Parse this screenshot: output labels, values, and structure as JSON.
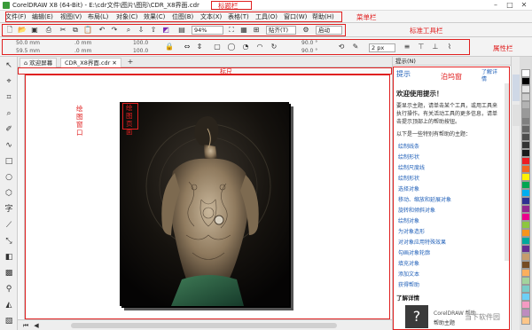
{
  "window": {
    "title": "CorelDRAW X8 (64-Bit) - E:\\cdr文件\\图片\\图形\\CDR_X8界面.cdr",
    "title_annotation": "标题栏"
  },
  "menu": {
    "items": [
      "文件(F)",
      "编辑(E)",
      "视图(V)",
      "布局(L)",
      "对象(C)",
      "效果(C)",
      "位图(B)",
      "文本(X)",
      "表格(T)",
      "工具(O)",
      "窗口(W)",
      "帮助(H)"
    ],
    "annotation": "菜单栏"
  },
  "standard_toolbar": {
    "zoom_value": "94%",
    "snap_label": "贴齐(T)",
    "launch_label": "启动",
    "annotation": "标准工具栏"
  },
  "property_bar": {
    "width_value": "50.0 mm",
    "height_value": "59.5 mm",
    "x_value": ".0 mm",
    "y_value": ".0 mm",
    "scale_x": "100.0",
    "scale_y": "100.0",
    "angle_1": "90.0 °",
    "angle_2": "90.0 °",
    "outline_width": "2 px",
    "annotation": "属性栏"
  },
  "tabs": {
    "welcome": "欢迎屏幕",
    "document": "CDR_X8界面.cdr"
  },
  "annotations": {
    "ruler": "标尺",
    "drawing_window": "绘图窗口",
    "drawing_page": "绘图页面",
    "docker": "泊坞窗"
  },
  "docker": {
    "header": "提示(N)",
    "panel_title": "提示",
    "learn_more": "了解详情",
    "welcome_title": "欢迎使用提示！",
    "intro_lines": [
      "要显示主题，请单击某个工具，或用工具来",
      "执行操作。有关活动工具的更多信息，请单",
      "击提示顶部上的帮助按钮。"
    ],
    "topics_intro": "以下是一些特别有帮助的主题：",
    "topics": [
      "绘制线条",
      "绘制形状",
      "绘制尺度线",
      "绘制形状",
      "选择对象",
      "移动、缩放和延展对象",
      "旋转和倾斜对象",
      "绘制对象",
      "为对象造形",
      "对对象应用特殊效果",
      "勾画对象轮廓",
      "填充对象",
      "添加文本",
      "获得帮助"
    ],
    "more_section": "了解详情",
    "help_box_line1": "CorelDRAW 帮助",
    "help_box_line2": "帮助主题"
  },
  "watermark": "当下软件园",
  "palette_colors": [
    "#ffffff",
    "#000000",
    "#e6e6e6",
    "#cccccc",
    "#b3b3b3",
    "#999999",
    "#808080",
    "#666666",
    "#4d4d4d",
    "#333333",
    "#1a1a1a",
    "#ed1c24",
    "#f26522",
    "#fff200",
    "#00a651",
    "#00aeef",
    "#2e3192",
    "#92278f",
    "#ec008c",
    "#8dc63f",
    "#f7941d",
    "#00a99d",
    "#662d91",
    "#c69c6d",
    "#754c24",
    "#fbaf5d",
    "#a3d39c",
    "#7accc8",
    "#6dcff6",
    "#f49ac2",
    "#bd8cbf",
    "#fdc689"
  ]
}
